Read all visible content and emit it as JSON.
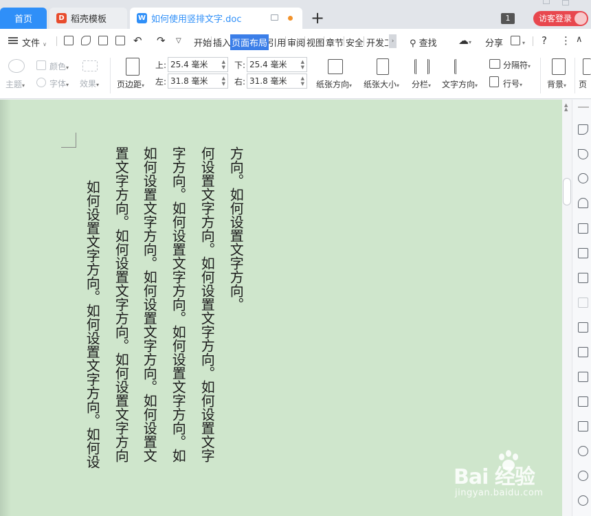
{
  "tabs": {
    "home": "首页",
    "template": "稻壳模板",
    "doc": "如何使用竖排文字.doc",
    "plus": "+",
    "counter": "1",
    "login": "访客登录"
  },
  "menu": {
    "file": "文件",
    "items": [
      "开始",
      "插入",
      "页面布局",
      "引用",
      "审阅",
      "视图",
      "章节",
      "安全",
      "开发工"
    ],
    "search": "查找",
    "share": "分享",
    "help": "?"
  },
  "ribbon": {
    "theme": "主题",
    "color": "颜色",
    "font": "字体",
    "effect": "效果",
    "margins": "页边距",
    "top_label": "上:",
    "top_value": "25.4 毫米",
    "bottom_label": "下:",
    "bottom_value": "25.4 毫米",
    "left_label": "左:",
    "left_value": "31.8 毫米",
    "right_label": "右:",
    "right_value": "31.8 毫米",
    "orientation": "纸张方向",
    "size": "纸张大小",
    "columns": "分栏",
    "text_direction": "文字方向",
    "separator": "分隔符",
    "line_number": "行号",
    "background": "背景",
    "page_border": "页"
  },
  "document": {
    "columns": [
      "方向。如何设置文字方向。",
      "何设置文字方向。如何设置文字方向。如何设置文字",
      "字方向。如何设置文字方向。如何设置文字方向。如",
      "如何设置文字方向。如何设置文字方向。如何设置文",
      "置文字方向。如何设置文字方向。如何设置文字方向",
      "如何设置文字方向。如何设置文字方向。如何设"
    ]
  },
  "watermark": {
    "brand": "Bai 经验",
    "url": "jingyan.baidu.com"
  },
  "colors": {
    "accent": "#2f8ff8",
    "login_red": "#e8474e",
    "doc_bg": "#cfe6cc"
  }
}
